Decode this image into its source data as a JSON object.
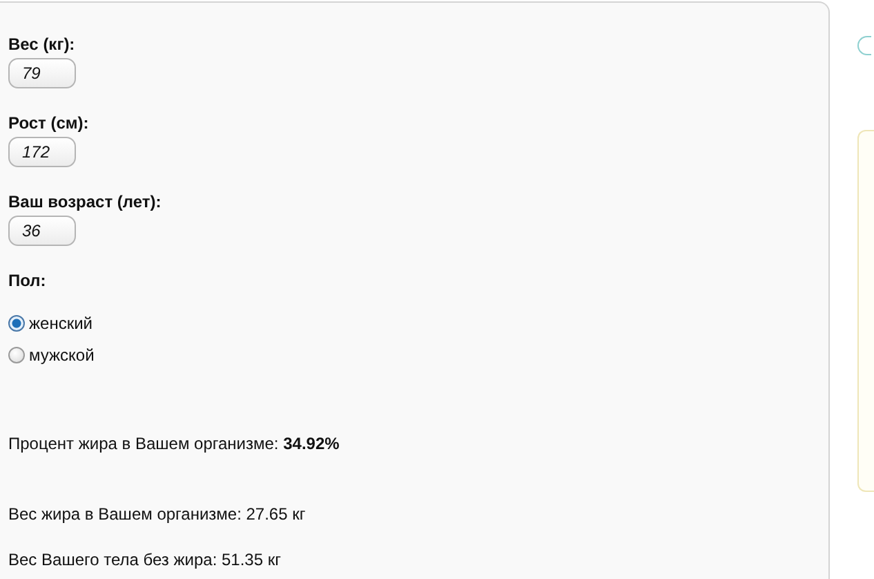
{
  "fields": [
    {
      "label": "Вес (кг):",
      "value": "79"
    },
    {
      "label": "Рост (см):",
      "value": "172"
    },
    {
      "label": "Ваш возраст (лет):",
      "value": "36"
    }
  ],
  "gender": {
    "label": "Пол:",
    "options": [
      {
        "label": "женский",
        "selected": true
      },
      {
        "label": "мужской",
        "selected": false
      }
    ]
  },
  "results": [
    "Процент жира в Вашем организме: **34.92%**",
    "Вес жира в Вашем организме: 27.65 кг",
    "Вес Вашего тела без жира: 51.35 кг"
  ]
}
